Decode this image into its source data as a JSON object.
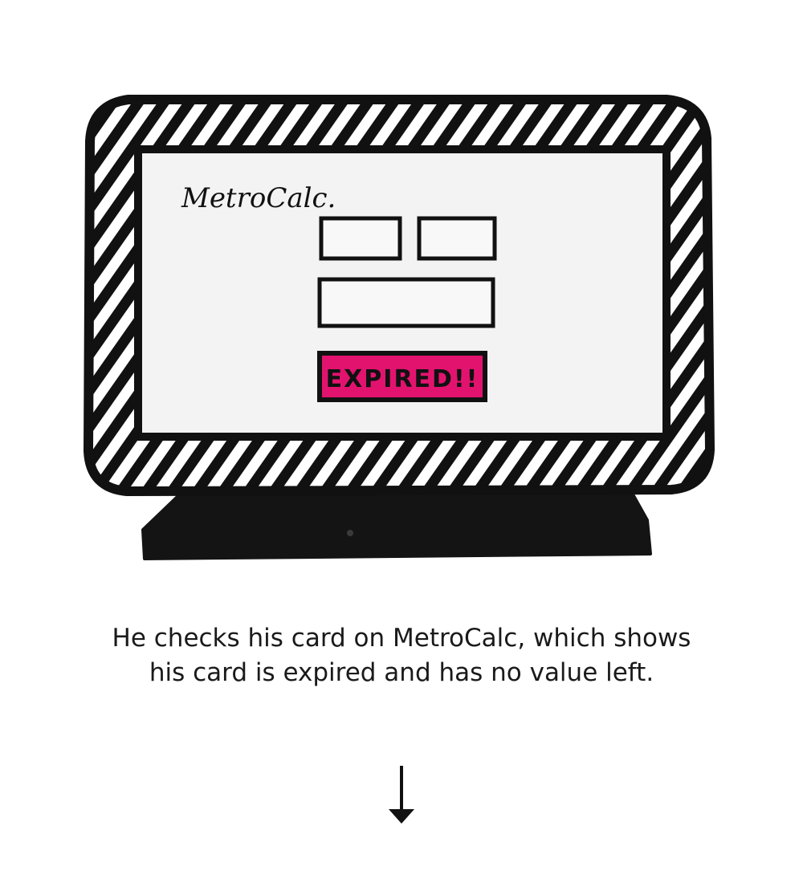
{
  "monitor": {
    "brand": "MetroCalc.",
    "status": "EXPIRED!!",
    "status_color": "#e2136e",
    "frame_color": "#111111",
    "screen_color": "#f3f3f3"
  },
  "caption": {
    "line1": "He checks his card on MetroCalc, which shows",
    "line2": "his card is expired and has no value left."
  },
  "arrow": {
    "icon": "arrow-down-icon"
  }
}
